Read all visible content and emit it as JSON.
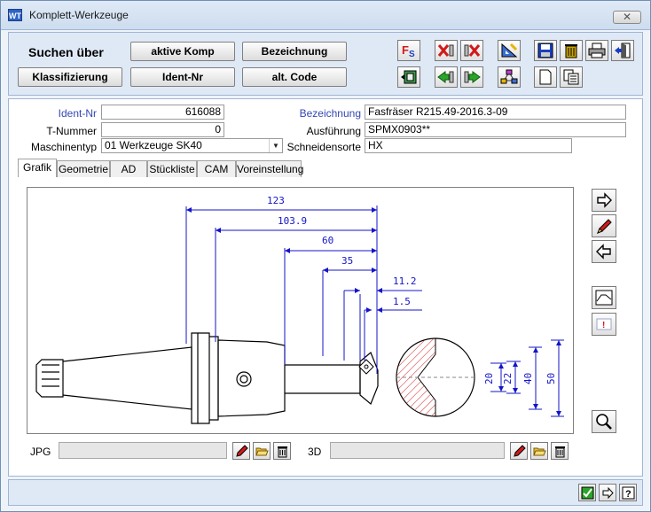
{
  "window": {
    "title": "Komplett-Werkzeuge",
    "app_icon_text": "WT",
    "close_glyph": "✕"
  },
  "search": {
    "label": "Suchen über",
    "buttons": [
      "aktive Komp",
      "Bezeichnung",
      "Klassifizierung",
      "Ident-Nr",
      "alt. Code"
    ]
  },
  "form": {
    "ident_nr_label": "Ident-Nr",
    "ident_nr_value": "616088",
    "t_nummer_label": "T-Nummer",
    "t_nummer_value": "0",
    "maschinentyp_label": "Maschinentyp",
    "maschinentyp_value": "01 Werkzeuge SK40",
    "bezeichnung_label": "Bezeichnung",
    "bezeichnung_value": "Fasfräser R215.49-2016.3-09",
    "ausfuehrung_label": "Ausführung",
    "ausfuehrung_value": "SPMX0903**",
    "schneidensorte_label": "Schneidensorte",
    "schneidensorte_value": "HX"
  },
  "tabs": [
    "Grafik",
    "Geometrie",
    "AD",
    "Stückliste",
    "CAM",
    "Voreinstellung"
  ],
  "drawing": {
    "dims": [
      "123",
      "103.9",
      "60",
      "35",
      "11.2",
      "1.5",
      "20",
      "22",
      "40",
      "50"
    ]
  },
  "bottom": {
    "jpg_label": "JPG",
    "threed_label": "3D"
  },
  "colors": {
    "dimension": "#1414c8",
    "accent": "#3348b4",
    "delete_red": "#d11a1a"
  }
}
